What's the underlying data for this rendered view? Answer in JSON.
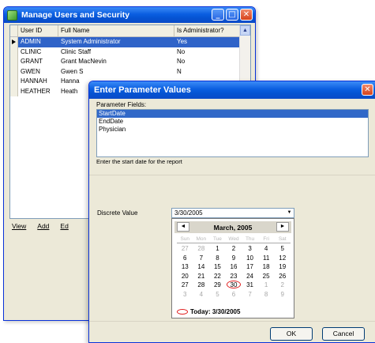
{
  "users_window": {
    "title": "Manage Users and Security",
    "columns": [
      "User ID",
      "Full Name",
      "Is Administrator?"
    ],
    "rows": [
      {
        "user_id": "ADMIN",
        "full_name": "System Administrator",
        "is_admin": "Yes",
        "selected": true
      },
      {
        "user_id": "CLINIC",
        "full_name": "Clinic Staff",
        "is_admin": "No"
      },
      {
        "user_id": "GRANT",
        "full_name": "Grant MacNevin",
        "is_admin": "No"
      },
      {
        "user_id": "GWEN",
        "full_name": "Gwen S",
        "is_admin": "N"
      },
      {
        "user_id": "HANNAH",
        "full_name": "Hanna",
        "is_admin": ""
      },
      {
        "user_id": "HEATHER",
        "full_name": "Heath",
        "is_admin": ""
      }
    ],
    "toolbar": {
      "view": "View",
      "add": "Add",
      "edit": "Ed"
    },
    "controls": {
      "minimize": "_",
      "maximize": "□",
      "close": "✕"
    }
  },
  "param_dialog": {
    "title": "Enter Parameter Values",
    "close": "✕",
    "fields_label": "Parameter Fields:",
    "fields": [
      "StartDate",
      "EndDate",
      "Physician"
    ],
    "description": "Enter the start date for the report",
    "discrete_label": "Discrete Value",
    "discrete_value": "3/30/2005",
    "calendar": {
      "month": "March, 2005",
      "prev": "◄",
      "next": "►",
      "weekdays": [
        "Sun",
        "Mon",
        "Tue",
        "Wed",
        "Thu",
        "Fri",
        "Sat"
      ],
      "days": [
        {
          "d": "27",
          "m": true
        },
        {
          "d": "28",
          "m": true
        },
        {
          "d": "1"
        },
        {
          "d": "2"
        },
        {
          "d": "3"
        },
        {
          "d": "4"
        },
        {
          "d": "5"
        },
        {
          "d": "6"
        },
        {
          "d": "7"
        },
        {
          "d": "8"
        },
        {
          "d": "9"
        },
        {
          "d": "10"
        },
        {
          "d": "11"
        },
        {
          "d": "12"
        },
        {
          "d": "13"
        },
        {
          "d": "14"
        },
        {
          "d": "15"
        },
        {
          "d": "16"
        },
        {
          "d": "17"
        },
        {
          "d": "18"
        },
        {
          "d": "19"
        },
        {
          "d": "20"
        },
        {
          "d": "21"
        },
        {
          "d": "22"
        },
        {
          "d": "23"
        },
        {
          "d": "24"
        },
        {
          "d": "25"
        },
        {
          "d": "26"
        },
        {
          "d": "27"
        },
        {
          "d": "28"
        },
        {
          "d": "29"
        },
        {
          "d": "30",
          "today": true
        },
        {
          "d": "31"
        },
        {
          "d": "1",
          "m": true
        },
        {
          "d": "2",
          "m": true
        },
        {
          "d": "3",
          "m": true
        },
        {
          "d": "4",
          "m": true
        },
        {
          "d": "5",
          "m": true
        },
        {
          "d": "6",
          "m": true
        },
        {
          "d": "7",
          "m": true
        },
        {
          "d": "8",
          "m": true
        },
        {
          "d": "9",
          "m": true
        }
      ],
      "today_text": "Today: 3/30/2005"
    },
    "ok": "OK",
    "cancel": "Cancel"
  },
  "colors": {
    "title_bar": "#0a5ee0",
    "selection": "#2f63c8",
    "today_circle": "#e02020"
  }
}
